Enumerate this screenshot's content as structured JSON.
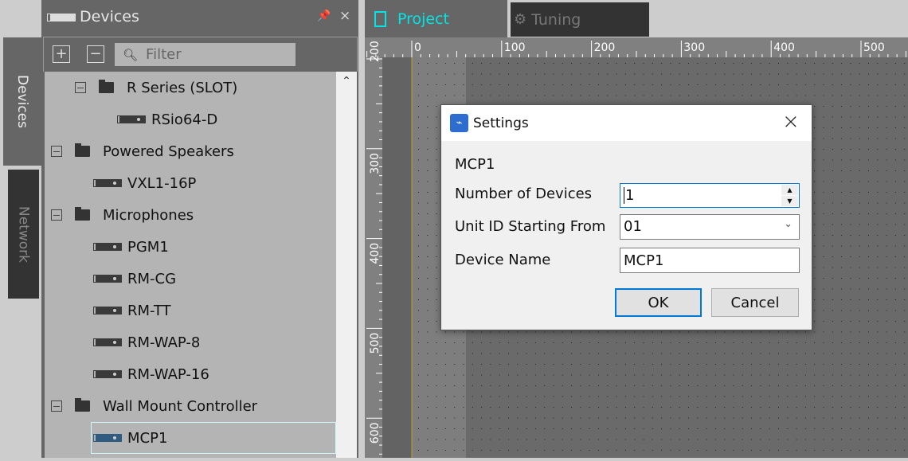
{
  "side_tabs": {
    "devices": "Devices",
    "network": "Network"
  },
  "panel": {
    "title": "Devices",
    "filter_placeholder": "Filter",
    "tree": [
      {
        "type": "folder",
        "label": "R Series (SLOT)",
        "level": 1
      },
      {
        "type": "device",
        "label": "RSio64-D",
        "level": 2
      },
      {
        "type": "folder",
        "label": "Powered Speakers",
        "level": 0
      },
      {
        "type": "device",
        "label": "VXL1-16P",
        "level": 1
      },
      {
        "type": "folder",
        "label": "Microphones",
        "level": 0
      },
      {
        "type": "device",
        "label": "PGM1",
        "level": 1
      },
      {
        "type": "device",
        "label": "RM-CG",
        "level": 1
      },
      {
        "type": "device",
        "label": "RM-TT",
        "level": 1
      },
      {
        "type": "device",
        "label": "RM-WAP-8",
        "level": 1
      },
      {
        "type": "device",
        "label": "RM-WAP-16",
        "level": 1
      },
      {
        "type": "folder",
        "label": "Wall Mount Controller",
        "level": 0
      },
      {
        "type": "device",
        "label": "MCP1",
        "level": 1,
        "selected": true
      }
    ]
  },
  "tabs": [
    {
      "label": "Project",
      "active": true
    },
    {
      "label": "Tuning",
      "active": false
    }
  ],
  "ruler": {
    "x_labels": [
      "0",
      "100",
      "200",
      "300",
      "400",
      "500"
    ],
    "y_labels": [
      "200",
      "300",
      "400",
      "500",
      "600"
    ]
  },
  "dialog": {
    "title": "Settings",
    "device": "MCP1",
    "number_of_devices_label": "Number of Devices",
    "number_of_devices": "1",
    "unit_id_label": "Unit ID Starting From",
    "unit_id": "01",
    "device_name_label": "Device Name",
    "device_name": "MCP1",
    "ok": "OK",
    "cancel": "Cancel"
  },
  "colors": {
    "accent": "#00e5e5",
    "dialog_focus": "#0078d7"
  }
}
